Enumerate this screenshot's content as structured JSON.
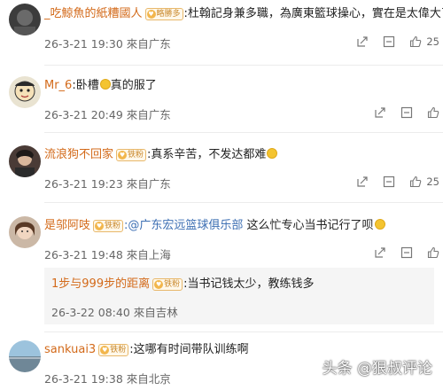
{
  "comments": [
    {
      "name": "_吃鯨魚的紙糟國人",
      "badge": "略勝多",
      "text": ":杜翰記身兼多職，為廣東籃球操心，實在是太偉大了",
      "time": "26-3-21 19:30",
      "location": "來自广东",
      "likes": "25"
    },
    {
      "name": "Mr_6",
      "text_before": ":卧槽",
      "text_after": "真的服了",
      "time": "26-3-21 20:49",
      "location": "來自广东"
    },
    {
      "name": "流浪狗不回家",
      "badge": "铁粉",
      "text": ":真系辛苦，不发达都难",
      "time": "26-3-21 19:23",
      "location": "來自广东",
      "likes": "25"
    },
    {
      "name": "是邬阿吱",
      "badge": "铁粉",
      "mention": ":@广东宏远篮球俱乐部",
      "text": " 这么忙专心当书记行了呗",
      "time": "26-3-21 19:48",
      "location": "來自上海",
      "reply": {
        "name": "1步与999步的距离",
        "badge": "铁粉",
        "text": ":当书记钱太少，教练钱多",
        "time": "26-3-22 08:40",
        "location": "來自吉林"
      }
    },
    {
      "name": "sankuai3",
      "badge": "铁粉",
      "text": ":这哪有时间带队训练啊",
      "time": "26-3-21 19:38",
      "location": "來自北京"
    }
  ],
  "watermark": "头条 @狠叔评论",
  "icons": [
    "share-icon",
    "comment-icon",
    "like-icon"
  ],
  "colors": {
    "name": "#d36a1a",
    "badge": "#c9892e",
    "mention": "#3d6fb3"
  }
}
